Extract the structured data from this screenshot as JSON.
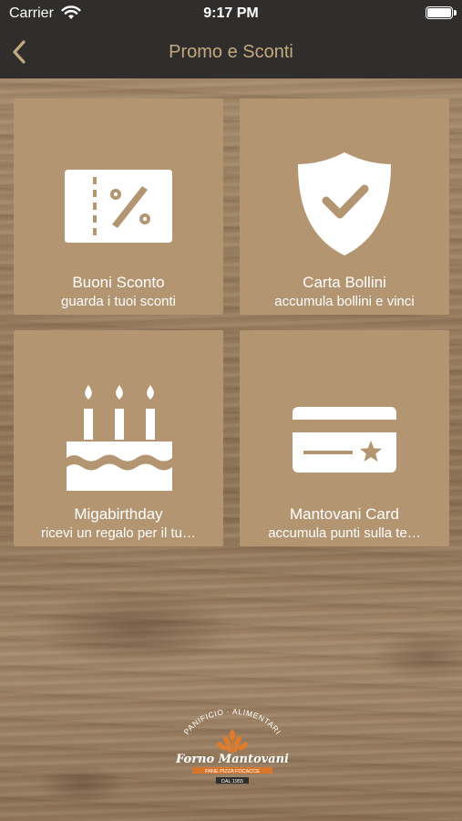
{
  "status_bar": {
    "carrier": "Carrier",
    "time": "9:17 PM",
    "battery_level": 1.0
  },
  "nav": {
    "title": "Promo e Sconti",
    "back_icon": "chevron-left-icon"
  },
  "tiles": [
    {
      "icon": "discount-coupon-icon",
      "title": "Buoni Sconto",
      "subtitle": "guarda i tuoi sconti"
    },
    {
      "icon": "shield-check-icon",
      "title": "Carta Bollini",
      "subtitle": "accumula bollini e vinci"
    },
    {
      "icon": "birthday-cake-icon",
      "title": "Migabirthday",
      "subtitle": "ricevi un regalo per il tu…"
    },
    {
      "icon": "card-star-icon",
      "title": "Mantovani Card",
      "subtitle": "accumula punti sulla te…"
    }
  ],
  "logo": {
    "arc_text": "PANIFICIO · ALIMENTARI",
    "name": "Forno Mantovani",
    "tagline": "PANE PIZZA FOCACCE",
    "since": "DAL 1955"
  },
  "colors": {
    "bars": "#2f2e2c",
    "title": "#c4a87f",
    "tile": "#b39571",
    "icon": "#ffffff"
  }
}
